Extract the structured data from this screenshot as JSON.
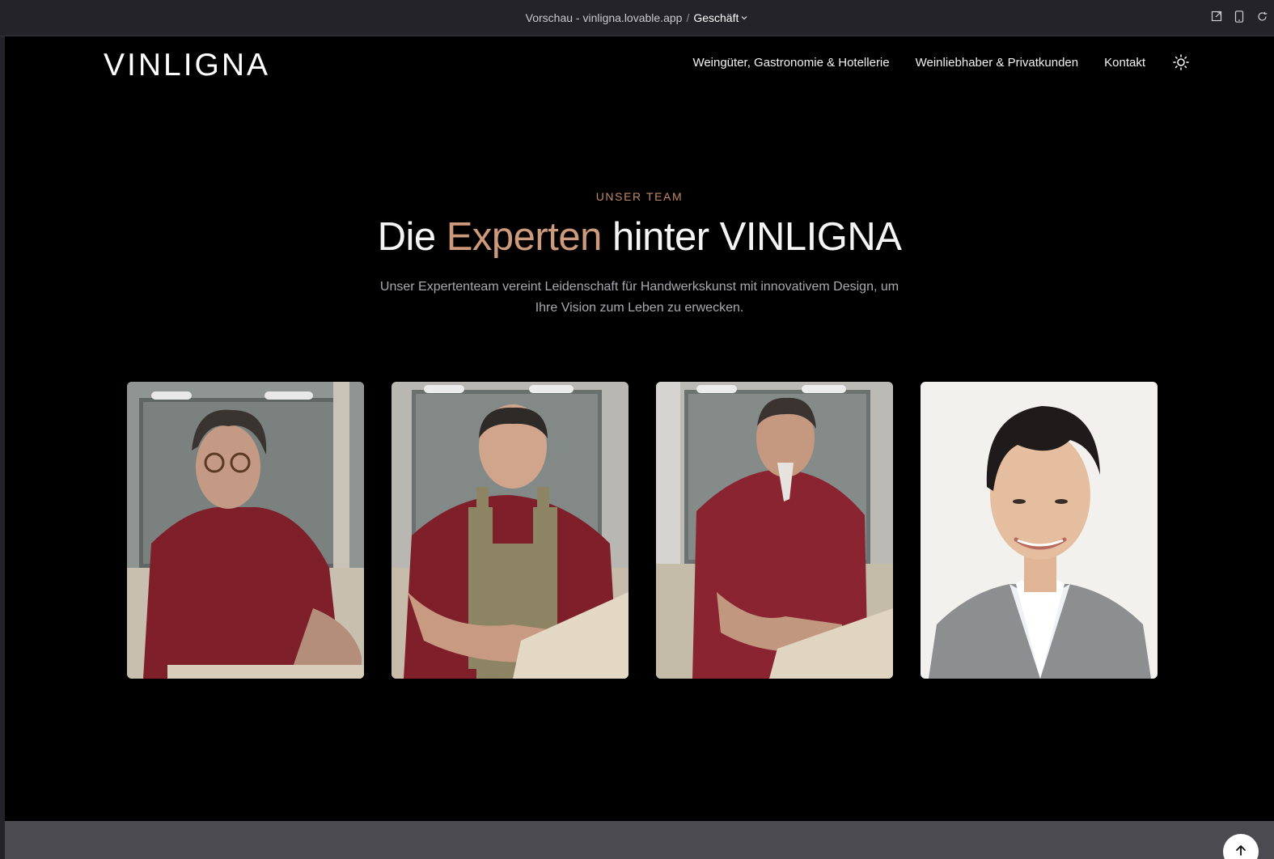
{
  "chrome": {
    "prefix": "Vorschau - vinligna.lovable.app",
    "separator": "/",
    "project": "Geschäft",
    "actions": [
      "open-external-icon",
      "mobile-preview-icon",
      "reload-icon"
    ]
  },
  "site": {
    "logo": "VINLIGNA",
    "nav": [
      {
        "label": "Weingüter, Gastronomie & Hotellerie"
      },
      {
        "label": "Weinliebhaber & Privatkunden"
      },
      {
        "label": "Kontakt"
      }
    ],
    "theme_toggle_icon": "sun-icon",
    "team": {
      "eyebrow": "UNSER TEAM",
      "headline_prefix": "Die",
      "headline_accent": "Experten",
      "headline_suffix": "hinter VINLIGNA",
      "lead_line1": "Unser Expertenteam vereint Leidenschaft für Handwerkskunst mit innovativem Design, um",
      "lead_line2": "Ihre Vision zum Leben zu erwecken.",
      "members": [
        {
          "photo": "team-photo-1"
        },
        {
          "photo": "team-photo-2"
        },
        {
          "photo": "team-photo-3"
        },
        {
          "photo": "team-photo-4"
        }
      ]
    },
    "scroll_top_icon": "arrow-up-icon"
  },
  "colors": {
    "accent": "#cd9a7b",
    "eyebrow": "#c2896a",
    "background": "#000000",
    "shirt": "#7e1f2a"
  }
}
